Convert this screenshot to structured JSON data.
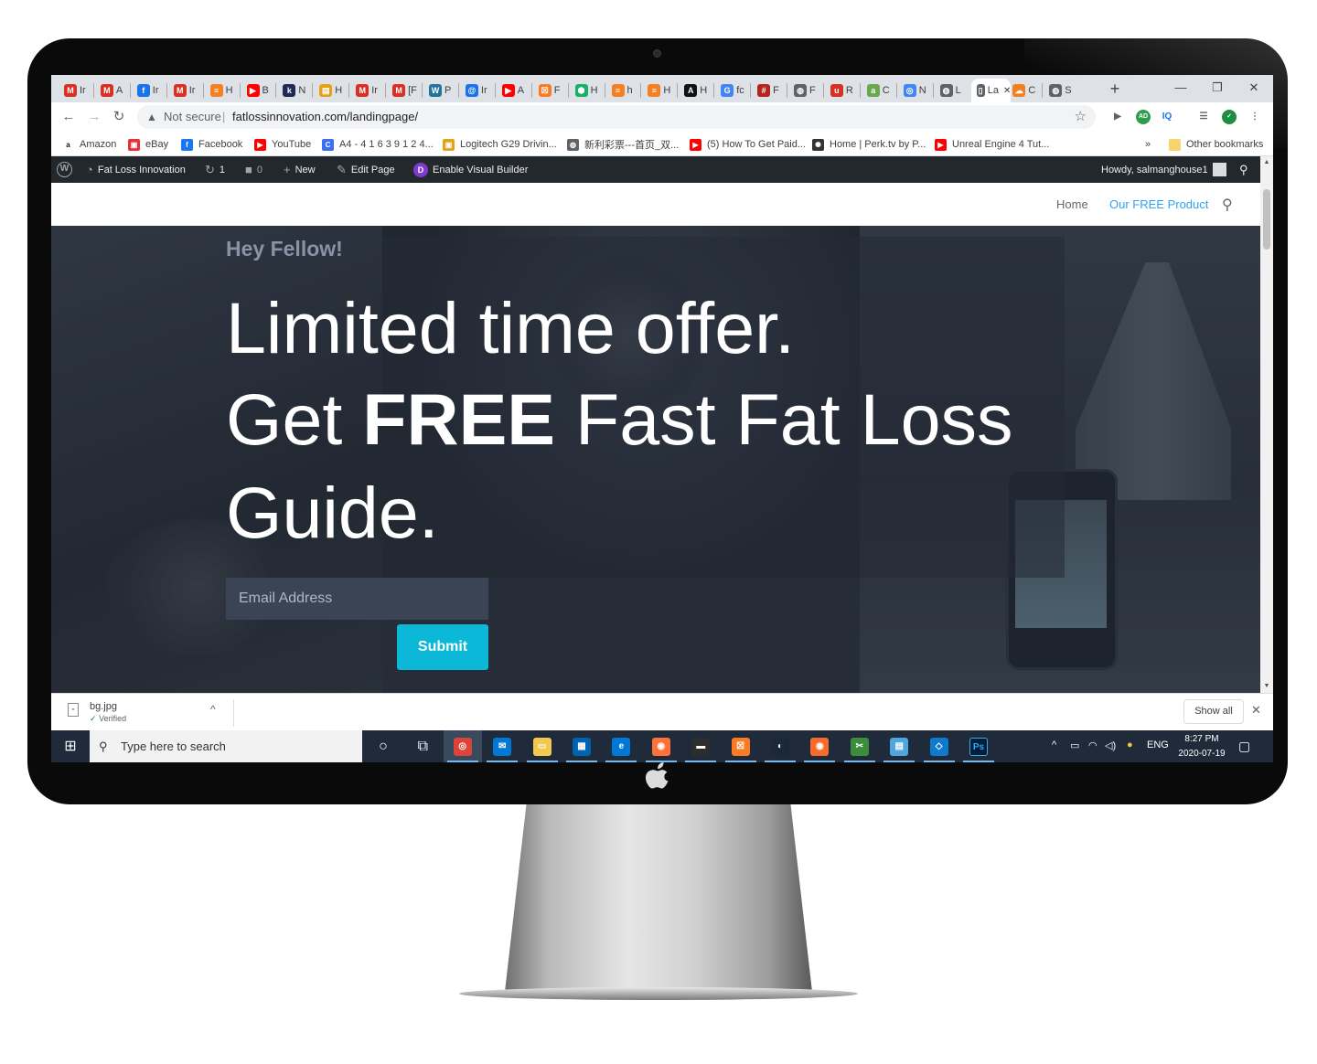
{
  "browser": {
    "tabs": [
      {
        "label": "Ir",
        "icon": "gmail-icon",
        "color": "#d93025",
        "glyph": "M"
      },
      {
        "label": "A",
        "icon": "gmail-icon",
        "color": "#d93025",
        "glyph": "M"
      },
      {
        "label": "Ir",
        "icon": "fiverr-icon",
        "color": "#1a73e8",
        "glyph": "f"
      },
      {
        "label": "Ir",
        "icon": "gmail-icon",
        "color": "#d93025",
        "glyph": "M"
      },
      {
        "label": "H",
        "icon": "stack-icon",
        "color": "#f48024",
        "glyph": "≡"
      },
      {
        "label": "B",
        "icon": "youtube-icon",
        "color": "#ff0000",
        "glyph": "▶"
      },
      {
        "label": "N",
        "icon": "k-icon",
        "color": "#1f2a57",
        "glyph": "k"
      },
      {
        "label": "H",
        "icon": "folder-icon",
        "color": "#e3a21a",
        "glyph": "▤"
      },
      {
        "label": "Ir",
        "icon": "gmail-icon",
        "color": "#d93025",
        "glyph": "M"
      },
      {
        "label": "[F",
        "icon": "gmail-icon",
        "color": "#d93025",
        "glyph": "M"
      },
      {
        "label": "P",
        "icon": "wordpress-icon",
        "color": "#21759b",
        "glyph": "W"
      },
      {
        "label": "Ir",
        "icon": "spiral-icon",
        "color": "#1a73e8",
        "glyph": "@"
      },
      {
        "label": "A",
        "icon": "youtube-icon",
        "color": "#ff0000",
        "glyph": "▶"
      },
      {
        "label": "F",
        "icon": "xampp-icon",
        "color": "#fb7a24",
        "glyph": "☒"
      },
      {
        "label": "H",
        "icon": "shield-icon",
        "color": "#17b26a",
        "glyph": "⬢"
      },
      {
        "label": "h",
        "icon": "stack-icon",
        "color": "#f48024",
        "glyph": "≡"
      },
      {
        "label": "H",
        "icon": "stack-icon",
        "color": "#f48024",
        "glyph": "≡"
      },
      {
        "label": "H",
        "icon": "a-icon",
        "color": "#111111",
        "glyph": "A"
      },
      {
        "label": "fc",
        "icon": "google-icon",
        "color": "#4285f4",
        "glyph": "G"
      },
      {
        "label": "F",
        "icon": "hacker-icon",
        "color": "#b3261e",
        "glyph": "#"
      },
      {
        "label": "F",
        "icon": "globe-icon",
        "color": "#5f6368",
        "glyph": "◍"
      },
      {
        "label": "R",
        "icon": "upwork-icon",
        "color": "#d93025",
        "glyph": "u"
      },
      {
        "label": "C",
        "icon": "grammar-icon",
        "color": "#6aa84f",
        "glyph": "a"
      },
      {
        "label": "N",
        "icon": "chrome-icon",
        "color": "#4285f4",
        "glyph": "◎"
      },
      {
        "label": "L",
        "icon": "globe-icon",
        "color": "#5f6368",
        "glyph": "◍"
      },
      {
        "label": "La",
        "icon": "page-icon",
        "color": "#5f6368",
        "glyph": "▯"
      },
      {
        "label": "C",
        "icon": "cloudflare-icon",
        "color": "#f38020",
        "glyph": "☁"
      },
      {
        "label": "S",
        "icon": "globe-icon",
        "color": "#5f6368",
        "glyph": "◍"
      }
    ],
    "active_tab_index": 25,
    "active_tab_close": "✕",
    "new_tab": "+",
    "window_controls": {
      "minimize": "—",
      "restore": "❐",
      "close": "✕"
    },
    "nav": {
      "back": "←",
      "forward": "→",
      "reload": "↻"
    },
    "address": {
      "warning": "▲",
      "not_secure": "Not secure",
      "separator": "|",
      "url": "fatlossinnovation.com/landingpage/",
      "star": "☆"
    },
    "extensions": [
      {
        "name": "video-ext-icon",
        "glyph": "▶",
        "color": "#5f6368"
      },
      {
        "name": "adblock-ext-icon",
        "glyph": "AD",
        "color": "#2e9d4e"
      },
      {
        "name": "iq-ext-icon",
        "glyph": "IQ",
        "color": "#1a73e8"
      },
      {
        "name": "playlist-ext-icon",
        "glyph": "☰",
        "color": "#5f6368"
      },
      {
        "name": "shield-ext-icon",
        "glyph": "✓",
        "color": "#1e8e3e"
      },
      {
        "name": "menu-ext-icon",
        "glyph": "⋮",
        "color": "#5f6368"
      }
    ],
    "bookmarks": [
      {
        "label": "Amazon",
        "glyph": "a",
        "color": "#111111"
      },
      {
        "label": "eBay",
        "glyph": "▣",
        "color": "#e53238"
      },
      {
        "label": "Facebook",
        "glyph": "f",
        "color": "#1877f2"
      },
      {
        "label": "YouTube",
        "glyph": "▶",
        "color": "#ff0000"
      },
      {
        "label": "A4 - 4 1 6 3 9 1 2 4...",
        "glyph": "C",
        "color": "#3b6ef5"
      },
      {
        "label": "Logitech G29 Drivin...",
        "glyph": "▣",
        "color": "#e3a21a"
      },
      {
        "label": "新利彩票---首页_双...",
        "glyph": "◍",
        "color": "#5f6368"
      },
      {
        "label": "(5) How To Get Paid...",
        "glyph": "▶",
        "color": "#ff0000"
      },
      {
        "label": "Home | Perk.tv by P...",
        "glyph": "✺",
        "color": "#333333"
      },
      {
        "label": "Unreal Engine 4 Tut...",
        "glyph": "▶",
        "color": "#ff0000"
      }
    ],
    "bookmarks_more": "»",
    "other_bookmarks": "Other bookmarks"
  },
  "wp_admin": {
    "logo": "W",
    "site_name": "Fat Loss Innovation",
    "updates_count": "1",
    "comments_count": "0",
    "new_label": "New",
    "edit_label": "Edit Page",
    "divi_glyph": "D",
    "builder_label": "Enable Visual Builder",
    "howdy": "Howdy, salmanghouse1"
  },
  "site": {
    "menu": [
      {
        "label": "Home",
        "color": "#666666"
      },
      {
        "label": "Our FREE Product",
        "color": "#2ea3f2"
      }
    ],
    "search_icon": "⚲"
  },
  "hero": {
    "kicker": "Hey Fellow!",
    "line1": "Limited time offer.",
    "line2_prefix": "Get ",
    "line2_bold": "FREE",
    "line2_suffix": " Fast Fat Loss",
    "line3": "Guide.",
    "email_placeholder": "Email Address",
    "submit_label": "Submit",
    "accent": "#0cb8d8"
  },
  "downloads": {
    "file_name": "bg.jpg",
    "status": "Verified",
    "check": "✓",
    "chevron": "^",
    "show_all": "Show all",
    "close": "✕"
  },
  "taskbar": {
    "start": "⊞",
    "search_placeholder": "Type here to search",
    "apps": [
      {
        "name": "cortana-icon",
        "glyph": "○",
        "color": "transparent"
      },
      {
        "name": "task-view-icon",
        "glyph": "⧉",
        "color": "transparent"
      },
      {
        "name": "chrome-app-icon",
        "glyph": "◎",
        "color": "#db4437"
      },
      {
        "name": "mail-app-icon",
        "glyph": "✉",
        "color": "#0078d4"
      },
      {
        "name": "explorer-app-icon",
        "glyph": "▭",
        "color": "#f2c94c"
      },
      {
        "name": "store-app-icon",
        "glyph": "▦",
        "color": "#0063b1"
      },
      {
        "name": "edge-app-icon",
        "glyph": "e",
        "color": "#0078d7"
      },
      {
        "name": "firefox-app-icon",
        "glyph": "◉",
        "color": "#ff7139"
      },
      {
        "name": "terminal-app-icon",
        "glyph": "▬",
        "color": "#2d2d2d"
      },
      {
        "name": "xampp-app-icon",
        "glyph": "☒",
        "color": "#fb7a24"
      },
      {
        "name": "steam-app-icon",
        "glyph": "◐",
        "color": "#1b2838"
      },
      {
        "name": "origin-app-icon",
        "glyph": "◉",
        "color": "#f56c2d"
      },
      {
        "name": "snipping-app-icon",
        "glyph": "✂",
        "color": "#3b8d3b"
      },
      {
        "name": "notepad-app-icon",
        "glyph": "▤",
        "color": "#4ea6dc"
      },
      {
        "name": "vscode-app-icon",
        "glyph": "◇",
        "color": "#0e7acc"
      },
      {
        "name": "photoshop-app-icon",
        "glyph": "Ps",
        "color": "#001e36"
      }
    ],
    "tray": {
      "chevron": "^",
      "battery": "▭",
      "wifi": "◠",
      "volume": "◁)",
      "weather": "●",
      "lang": "ENG"
    },
    "time": "8:27 PM",
    "date": "2020-07-19",
    "notifications": "▢"
  },
  "device": {
    "apple_logo": ""
  }
}
